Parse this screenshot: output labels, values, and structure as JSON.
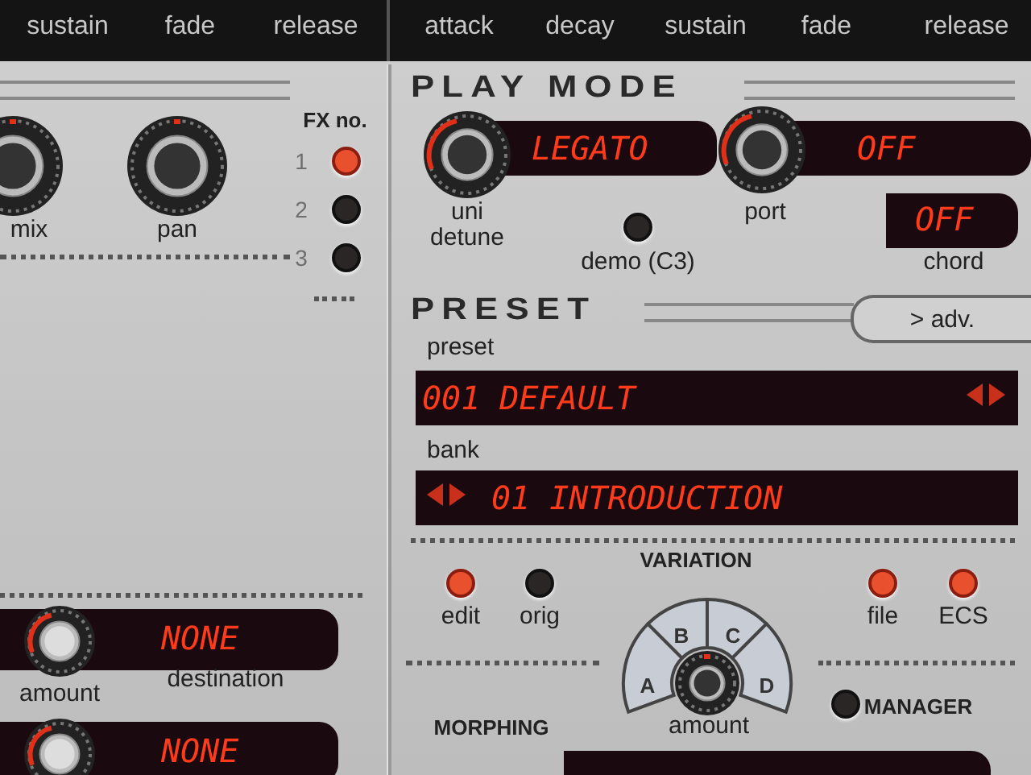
{
  "top_bar": {
    "left_labels": [
      "sustain",
      "fade",
      "release"
    ],
    "right_labels": [
      "attack",
      "decay",
      "sustain",
      "fade",
      "release"
    ]
  },
  "fx_section": {
    "knobs": [
      {
        "label": "mix"
      },
      {
        "label": "pan"
      }
    ],
    "fx_heading": "FX no.",
    "fx_slots": [
      {
        "number": "1",
        "selected": true
      },
      {
        "number": "2",
        "selected": false
      },
      {
        "number": "3",
        "selected": false
      }
    ]
  },
  "modulation_rows": [
    {
      "display": "NONE",
      "knob_label": "amount",
      "caption": "destination"
    },
    {
      "display": "NONE"
    }
  ],
  "play_mode": {
    "title": "PLAY MODE",
    "mode_display": "LEGATO",
    "mode_knob_label": [
      "uni",
      "detune"
    ],
    "port_display": "OFF",
    "port_label": "port",
    "demo_label": "demo (C3)",
    "demo_on": false,
    "chord_display": "OFF",
    "chord_label": "chord"
  },
  "preset": {
    "title": "PRESET",
    "adv_button": "> adv.",
    "preset_label": "preset",
    "preset_value": "001 DEFAULT",
    "bank_label": "bank",
    "bank_value": "01 INTRODUCTION"
  },
  "variation": {
    "title": "VARIATION",
    "leds": [
      {
        "label": "edit",
        "on": true
      },
      {
        "label": "orig",
        "on": false
      },
      {
        "label": "file",
        "on": true
      },
      {
        "label": "ECS",
        "on": true
      }
    ],
    "segments": [
      "A",
      "B",
      "C",
      "D"
    ],
    "knob_label": "amount"
  },
  "morphing": {
    "label": "MORPHING"
  },
  "manager": {
    "label": "MANAGER",
    "on": false
  }
}
